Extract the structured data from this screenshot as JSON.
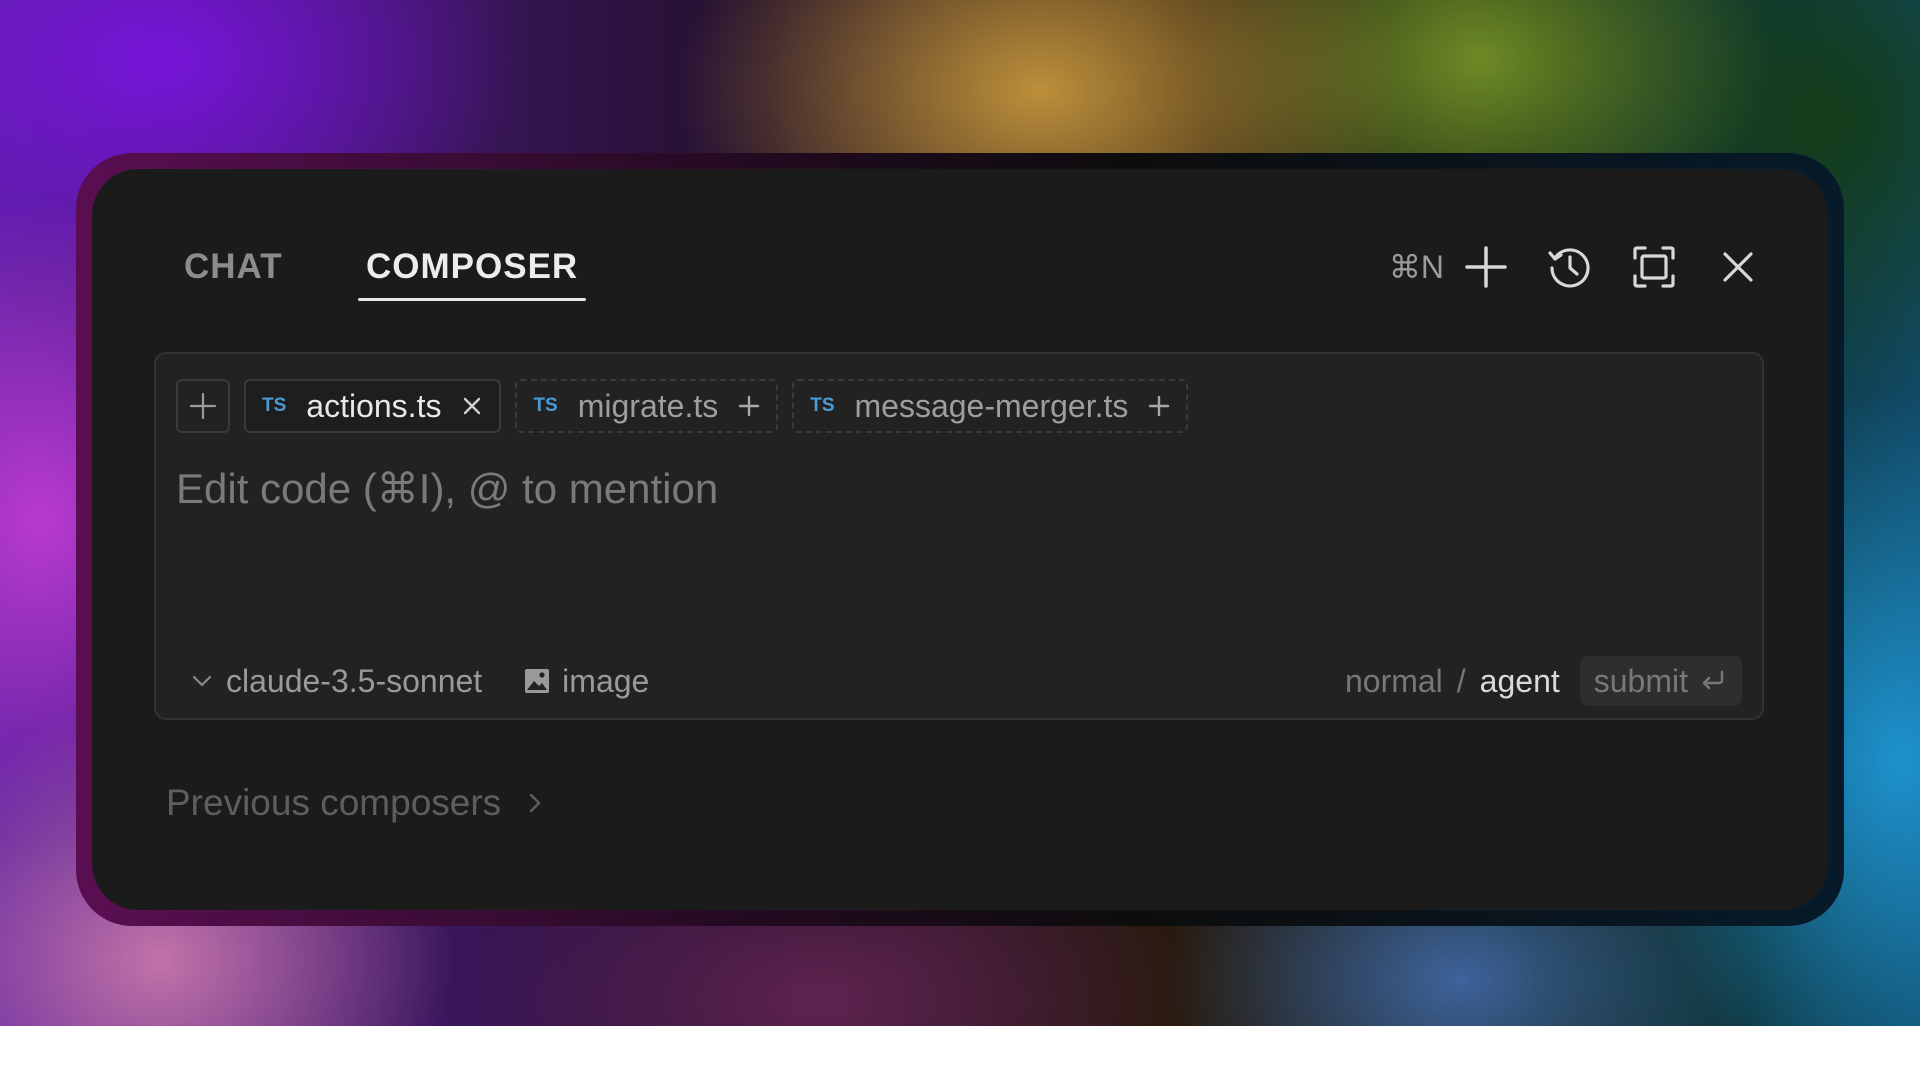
{
  "tabs": [
    {
      "label": "CHAT",
      "active": false
    },
    {
      "label": "COMPOSER",
      "active": true
    }
  ],
  "toolbar": {
    "shortcut": "⌘N",
    "buttons": [
      {
        "icon": "plus-icon"
      },
      {
        "icon": "history-icon"
      },
      {
        "icon": "maximize-icon"
      },
      {
        "icon": "close-icon"
      }
    ]
  },
  "context": {
    "add_icon": "plus-icon",
    "files": [
      {
        "type": "TS",
        "name": "actions.ts",
        "state": "attached",
        "action_icon": "close-icon"
      },
      {
        "type": "TS",
        "name": "migrate.ts",
        "state": "suggested",
        "action_icon": "plus-icon"
      },
      {
        "type": "TS",
        "name": "message-merger.ts",
        "state": "suggested",
        "action_icon": "plus-icon"
      }
    ]
  },
  "editor": {
    "placeholder": "Edit code (⌘I), @ to mention"
  },
  "footer": {
    "model": "claude-3.5-sonnet",
    "image_label": "image",
    "mode_normal": "normal",
    "mode_separator": "/",
    "mode_agent": "agent",
    "submit_label": "submit"
  },
  "previous": {
    "label": "Previous composers"
  },
  "colors": {
    "panel": "#1b1b1b",
    "input_bg": "#222222",
    "ts_badge": "#4a9bd6"
  }
}
